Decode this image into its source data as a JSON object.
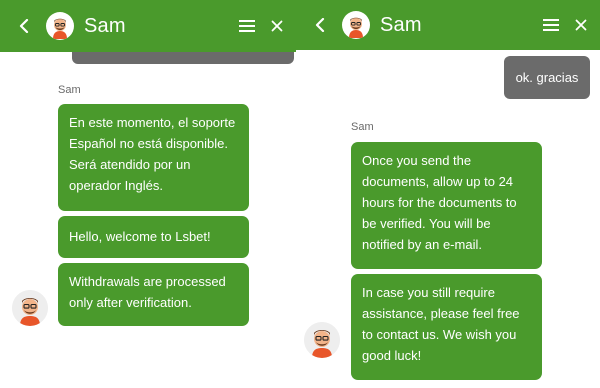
{
  "left_pane": {
    "header": {
      "title": "Sam",
      "back_icon": "chevron-left-icon",
      "menu_icon": "hamburger-menu-icon",
      "close_icon": "close-icon"
    },
    "sender_label": "Sam",
    "messages": [
      "En este momento, el soporte Español no está disponible. Será atendido por un operador Inglés.",
      "Hello, welcome to Lsbet!",
      "Withdrawals are processed only after verification."
    ]
  },
  "right_pane": {
    "header": {
      "title": "Sam",
      "back_icon": "chevron-left-icon",
      "menu_icon": "hamburger-menu-icon",
      "close_icon": "close-icon"
    },
    "user_message": "ok. gracias",
    "sender_label": "Sam",
    "messages": [
      "Once you send the documents, allow up to 24 hours for the documents to be verified. You will be notified by an e-mail.",
      "In case you still require assistance, please feel free to contact us. We wish you good luck!"
    ]
  },
  "colors": {
    "brand_green": "#4a9a2c",
    "user_bubble": "#6b6b6b",
    "sender_text": "#6a6a6a"
  }
}
